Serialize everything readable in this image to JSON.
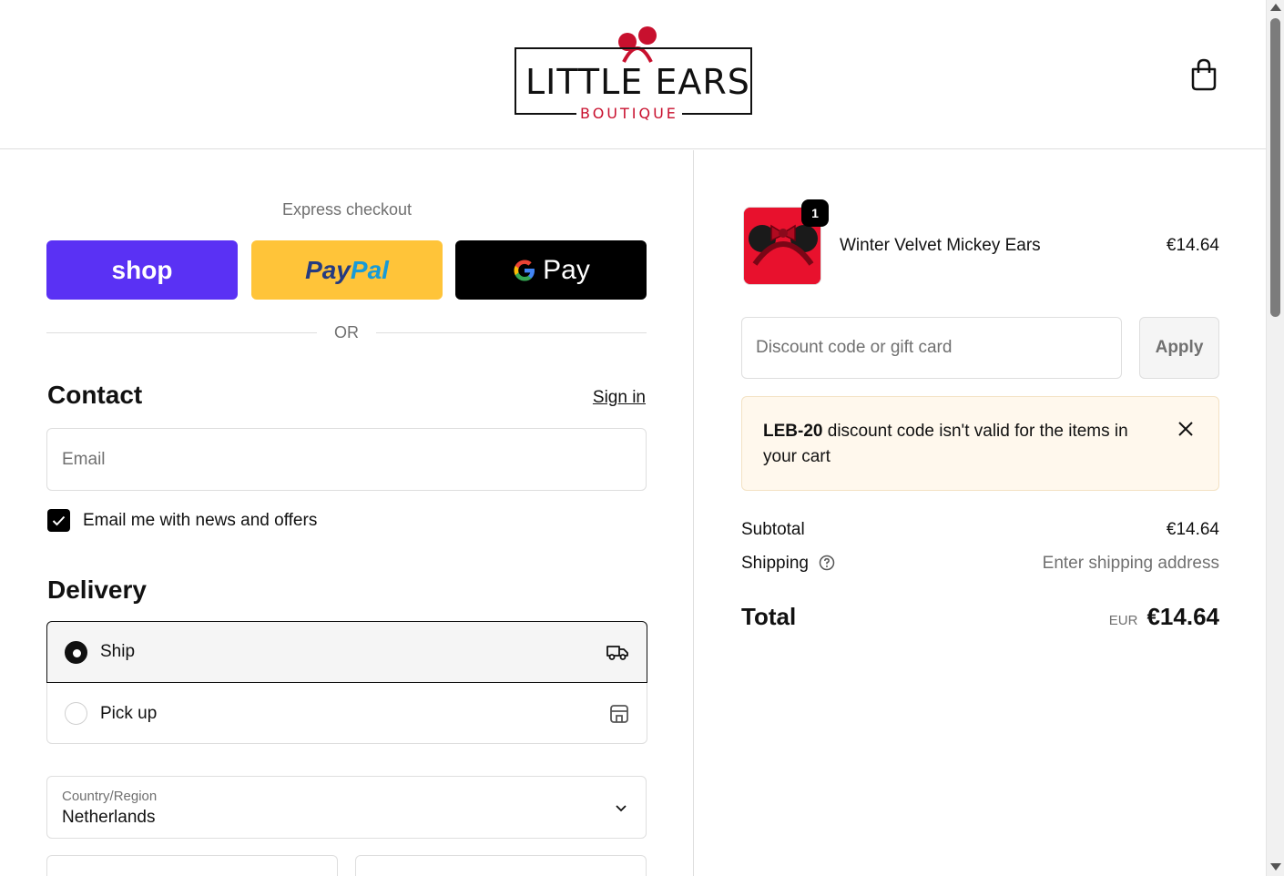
{
  "header": {
    "logo_main": "LITTLE EARS",
    "logo_sub": "BOUTIQUE",
    "brand_color": "#c8102e",
    "cart_icon": "shopping-bag-icon"
  },
  "express": {
    "title": "Express checkout",
    "shop_label": "shop",
    "paypal_label_1": "Pay",
    "paypal_label_2": "Pal",
    "gpay_label": "Pay",
    "or_text": "OR",
    "shop_color": "#5a31f4",
    "paypal_color": "#ffc439",
    "gpay_color": "#000000"
  },
  "contact": {
    "heading": "Contact",
    "signin_label": "Sign in",
    "email_placeholder": "Email",
    "email_value": "",
    "newsletter_label": "Email me with news and offers",
    "newsletter_checked": true
  },
  "delivery": {
    "heading": "Delivery",
    "options": [
      {
        "label": "Ship",
        "selected": true,
        "icon": "truck-icon"
      },
      {
        "label": "Pick up",
        "selected": false,
        "icon": "store-icon"
      }
    ],
    "country_label": "Country/Region",
    "country_value": "Netherlands"
  },
  "summary": {
    "item": {
      "name": "Winter Velvet Mickey Ears",
      "price": "€14.64",
      "quantity": "1"
    },
    "discount_placeholder": "Discount code or gift card",
    "apply_label": "Apply",
    "alert": {
      "code": "LEB-20",
      "message": " discount code isn't valid for the items in your cart"
    },
    "subtotal_label": "Subtotal",
    "subtotal_value": "€14.64",
    "shipping_label": "Shipping",
    "shipping_value": "Enter shipping address",
    "total_label": "Total",
    "total_currency": "EUR",
    "total_value": "€14.64"
  }
}
